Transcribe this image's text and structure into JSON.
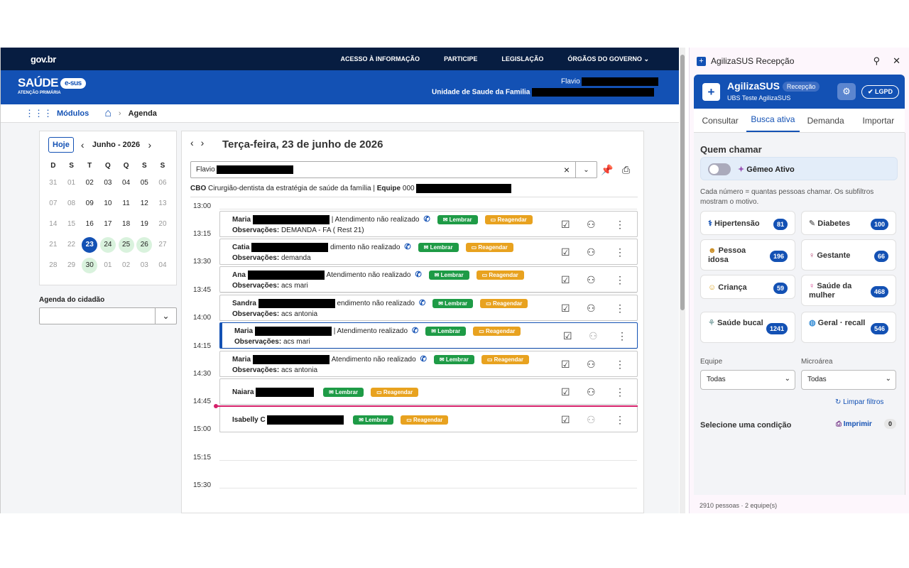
{
  "gov": {
    "logo": "gov.br",
    "links": [
      "ACESSO À INFORMAÇÃO",
      "PARTICIPE",
      "LEGISLAÇÃO",
      "ÓRGÃOS DO GOVERNO"
    ]
  },
  "saude": {
    "brand": "SAÚDE",
    "esus": "e-sus",
    "sub": "ATENÇÃO PRIMÁRIA",
    "user": "Flavio",
    "unit": "Unidade de Saude da Familia"
  },
  "nav": {
    "modulos": "Módulos",
    "crumb": "Agenda"
  },
  "calendar": {
    "today": "Hoje",
    "month": "Junho - 2026",
    "dow": [
      "D",
      "S",
      "T",
      "Q",
      "Q",
      "S",
      "S"
    ],
    "weeks": [
      [
        [
          "31",
          "out"
        ],
        [
          "01",
          "out"
        ],
        [
          "02",
          ""
        ],
        [
          "03",
          ""
        ],
        [
          "04",
          ""
        ],
        [
          "05",
          ""
        ],
        [
          "06",
          "out"
        ]
      ],
      [
        [
          "07",
          "out"
        ],
        [
          "08",
          "out"
        ],
        [
          "09",
          ""
        ],
        [
          "10",
          ""
        ],
        [
          "11",
          ""
        ],
        [
          "12",
          ""
        ],
        [
          "13",
          "out"
        ]
      ],
      [
        [
          "14",
          "out"
        ],
        [
          "15",
          "out"
        ],
        [
          "16",
          ""
        ],
        [
          "17",
          ""
        ],
        [
          "18",
          ""
        ],
        [
          "19",
          ""
        ],
        [
          "20",
          "out"
        ]
      ],
      [
        [
          "21",
          "out"
        ],
        [
          "22",
          "out"
        ],
        [
          "23",
          "sel"
        ],
        [
          "24",
          "avail"
        ],
        [
          "25",
          "avail"
        ],
        [
          "26",
          "avail"
        ],
        [
          "27",
          "out"
        ]
      ],
      [
        [
          "28",
          "out"
        ],
        [
          "29",
          "out"
        ],
        [
          "30",
          "avail"
        ],
        [
          "01",
          "out"
        ],
        [
          "02",
          "out"
        ],
        [
          "03",
          "out"
        ],
        [
          "04",
          "out"
        ]
      ]
    ]
  },
  "agenda_cidadao": {
    "label": "Agenda do cidadão"
  },
  "schedule": {
    "date": "Terça-feira, 23 de junho de 2026",
    "professional": "Flavio",
    "cbo_label": "CBO",
    "cbo": "Cirurgião-dentista da estratégia de saúde da família",
    "equipe_label": "Equipe",
    "equipe": "000",
    "times": [
      "13:00",
      "13:15",
      "13:30",
      "13:45",
      "14:00",
      "14:15",
      "14:30",
      "14:45",
      "15:00",
      "15:15",
      "15:30"
    ],
    "lembrar": "Lembrar",
    "reagendar": "Reagendar",
    "obs_label": "Observações:",
    "appointments": [
      {
        "name": "Maria",
        "status": "| Atendimento não realizado",
        "obs": "DEMANDA - FA ( Rest 21)"
      },
      {
        "name": "Catia",
        "status": "dimento não realizado",
        "obs": "demanda"
      },
      {
        "name": "Ana",
        "status": "Atendimento não realizado",
        "obs": "acs mari"
      },
      {
        "name": "Sandra",
        "status": "endimento não realizado",
        "obs": "acs antonia"
      },
      {
        "name": "Maria",
        "status": "| Atendimento realizado",
        "obs": "acs mari"
      },
      {
        "name": "Maria",
        "status": "Atendimento não realizado",
        "obs": "acs antonia"
      },
      {
        "name": "Naiara",
        "status": "",
        "obs": ""
      },
      {
        "name": "Isabelly C",
        "status": "",
        "obs": ""
      }
    ]
  },
  "panel": {
    "title": "AgilizaSUS Recepção",
    "brand": "AgilizaSUS",
    "role": "Recepção",
    "ubs": "UBS Teste AgilizaSUS",
    "lgpd": "LGPD",
    "tabs": [
      "Consultar",
      "Busca ativa",
      "Demanda",
      "Importar"
    ],
    "quem_chamar": "Quem chamar",
    "gemeo": "Gêmeo Ativo",
    "hint": "Cada número = quantas pessoas chamar. Os subfiltros mostram o motivo.",
    "conditions": [
      {
        "label": "Hipertensão",
        "count": "81"
      },
      {
        "label": "Diabetes",
        "count": "100"
      },
      {
        "label": "Pessoa idosa",
        "count": "196"
      },
      {
        "label": "Gestante",
        "count": "66"
      },
      {
        "label": "Criança",
        "count": "59"
      },
      {
        "label": "Saúde da mulher",
        "count": "468"
      },
      {
        "label": "Saúde bucal",
        "count": "1241"
      },
      {
        "label": "Geral · recall",
        "count": "546"
      }
    ],
    "equipe_label": "Equipe",
    "equipe_value": "Todas",
    "microarea_label": "Microárea",
    "microarea_value": "Todas",
    "limpar": "Limpar filtros",
    "selecione": "Selecione uma condição",
    "imprimir": "Imprimir",
    "selected_count": "0",
    "footer": "2910 pessoas · 2 equipe(s)"
  },
  "colors": {
    "primary": "#1351b4",
    "govbar": "#071d41",
    "green": "#1e9b46",
    "orange": "#e8a21f",
    "now": "#d5206a"
  }
}
